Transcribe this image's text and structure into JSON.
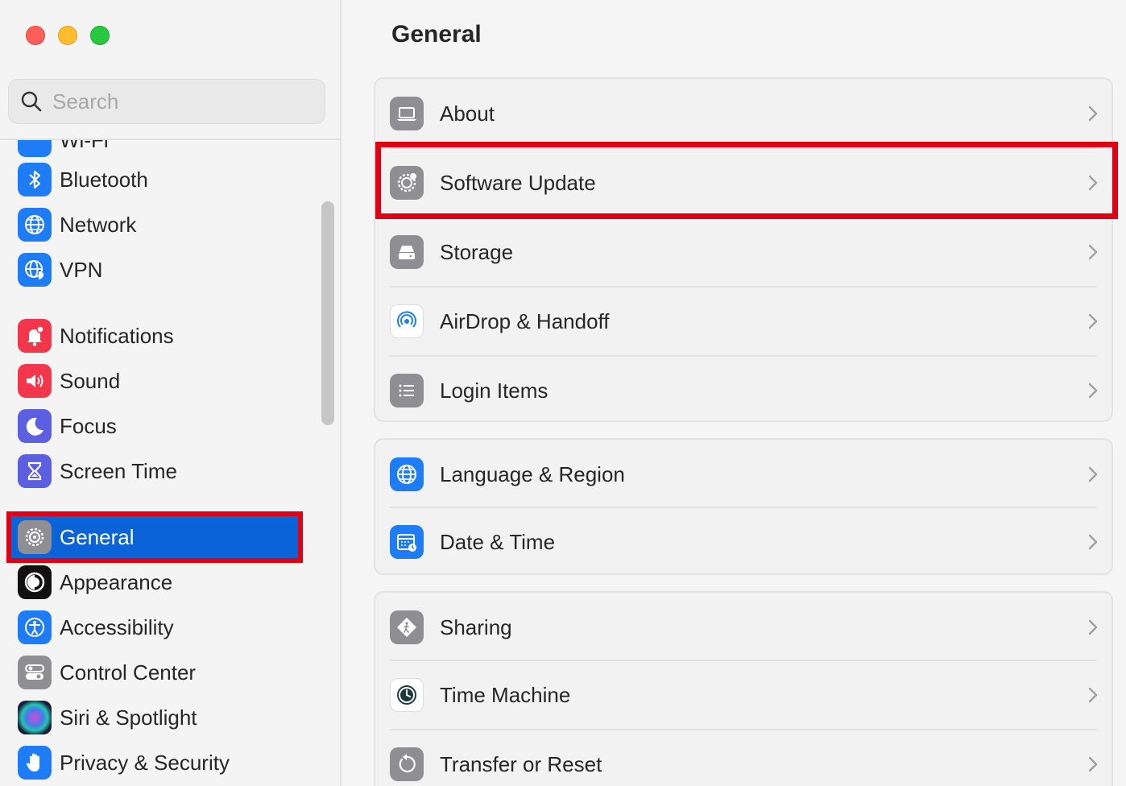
{
  "window": {
    "controls": [
      "close",
      "minimize",
      "zoom"
    ]
  },
  "search": {
    "placeholder": "Search"
  },
  "sidebar": {
    "partial_item": "Wi-Fi",
    "items": [
      {
        "label": "Bluetooth",
        "icon": "bluetooth-icon",
        "color": "#1e7cf6"
      },
      {
        "label": "Network",
        "icon": "globe-icon",
        "color": "#1e7cf6"
      },
      {
        "label": "VPN",
        "icon": "vpn-globe-icon",
        "color": "#1e7cf6"
      },
      {
        "label": "Notifications",
        "icon": "bell-icon",
        "color": "#f2364c"
      },
      {
        "label": "Sound",
        "icon": "speaker-icon",
        "color": "#f2364c"
      },
      {
        "label": "Focus",
        "icon": "moon-icon",
        "color": "#5b5fe0"
      },
      {
        "label": "Screen Time",
        "icon": "hourglass-icon",
        "color": "#5b5fe0"
      },
      {
        "label": "General",
        "icon": "gear-icon",
        "color": "#8e8e93",
        "selected": true
      },
      {
        "label": "Appearance",
        "icon": "appearance-icon",
        "color": "#111111"
      },
      {
        "label": "Accessibility",
        "icon": "accessibility-icon",
        "color": "#1e7cf6"
      },
      {
        "label": "Control Center",
        "icon": "toggles-icon",
        "color": "#8e8e93"
      },
      {
        "label": "Siri & Spotlight",
        "icon": "siri-icon",
        "color": "#222244"
      },
      {
        "label": "Privacy & Security",
        "icon": "hand-icon",
        "color": "#1e7cf6"
      }
    ]
  },
  "main": {
    "title": "General",
    "groups": [
      {
        "rows": [
          {
            "label": "About",
            "icon": "laptop-icon"
          },
          {
            "label": "Software Update",
            "icon": "gear-update-icon",
            "highlighted": true
          },
          {
            "label": "Storage",
            "icon": "drive-icon"
          },
          {
            "label": "AirDrop & Handoff",
            "icon": "airdrop-icon"
          },
          {
            "label": "Login Items",
            "icon": "list-icon"
          }
        ]
      },
      {
        "rows": [
          {
            "label": "Language & Region",
            "icon": "globe-icon"
          },
          {
            "label": "Date & Time",
            "icon": "calendar-clock-icon"
          }
        ]
      },
      {
        "rows": [
          {
            "label": "Sharing",
            "icon": "sharing-icon"
          },
          {
            "label": "Time Machine",
            "icon": "time-machine-icon"
          },
          {
            "label": "Transfer or Reset",
            "icon": "reset-icon"
          }
        ]
      }
    ]
  },
  "colors": {
    "accent": "#0a64d8",
    "highlight": "#e00012"
  }
}
